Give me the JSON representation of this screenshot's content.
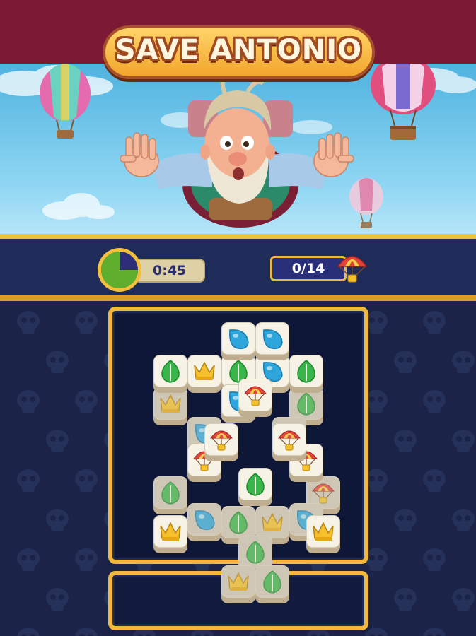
{
  "header": {
    "title": "SAVE ANTONIO"
  },
  "status": {
    "timer_text": "0:45",
    "timer_fraction_remaining": 0.75,
    "goal_text": "0/14"
  },
  "colors": {
    "banner": "#7c1a35",
    "title_fill": "#f2a52c",
    "board_border": "#f1b83a",
    "board_bg": "#0f1738",
    "timer_green": "#5fae2e",
    "timer_purple": "#2e2d7a",
    "leaf": "#39b54a",
    "drop": "#2ea6dc",
    "crown": "#f5c02b",
    "parachute": "#e0433b"
  },
  "board": {
    "tiles": [
      {
        "glyph": "drop-icon",
        "row": 0,
        "col": 2,
        "layer": 2
      },
      {
        "glyph": "drop-icon",
        "row": 0,
        "col": 3,
        "layer": 2
      },
      {
        "glyph": "leaf-icon",
        "row": 1,
        "col": 0,
        "layer": 1
      },
      {
        "glyph": "crown-icon",
        "row": 1,
        "col": 1,
        "layer": 1
      },
      {
        "glyph": "leaf-icon",
        "row": 1,
        "col": 2,
        "layer": 1
      },
      {
        "glyph": "drop-icon",
        "row": 1,
        "col": 3,
        "layer": 1
      },
      {
        "glyph": "leaf-icon",
        "row": 1,
        "col": 4,
        "layer": 1
      },
      {
        "glyph": "crown-icon",
        "row": 2,
        "col": 0,
        "layer": 0
      },
      {
        "glyph": "drop-icon",
        "row": 2,
        "col": 2,
        "layer": 1
      },
      {
        "glyph": "leaf-icon",
        "row": 2,
        "col": 4,
        "layer": 0
      },
      {
        "glyph": "parachute-icon",
        "row": 2,
        "col": 2.5,
        "layer": 3
      },
      {
        "glyph": "drop-icon",
        "row": 3,
        "col": 1,
        "layer": 0
      },
      {
        "glyph": "drop-icon",
        "row": 3,
        "col": 3.5,
        "layer": 0
      },
      {
        "glyph": "parachute-icon",
        "row": 3.5,
        "col": 1.5,
        "layer": 3
      },
      {
        "glyph": "parachute-icon",
        "row": 3.5,
        "col": 3.5,
        "layer": 3
      },
      {
        "glyph": "parachute-icon",
        "row": 4,
        "col": 1,
        "layer": 1
      },
      {
        "glyph": "parachute-icon",
        "row": 4,
        "col": 4,
        "layer": 1
      },
      {
        "glyph": "leaf-icon",
        "row": 5,
        "col": 0,
        "layer": 0
      },
      {
        "glyph": "parachute-icon",
        "row": 5,
        "col": 4.5,
        "layer": 0
      },
      {
        "glyph": "leaf-icon",
        "row": 5,
        "col": 2.5,
        "layer": 3
      },
      {
        "glyph": "drop-icon",
        "row": 6,
        "col": 1,
        "layer": 1
      },
      {
        "glyph": "drop-icon",
        "row": 6,
        "col": 4,
        "layer": 1
      },
      {
        "glyph": "crown-icon",
        "row": 6.5,
        "col": 0,
        "layer": 2
      },
      {
        "glyph": "crown-icon",
        "row": 6.5,
        "col": 4.5,
        "layer": 2
      },
      {
        "glyph": "leaf-icon",
        "row": 6,
        "col": 2,
        "layer": 0
      },
      {
        "glyph": "crown-icon",
        "row": 6,
        "col": 3,
        "layer": 0
      },
      {
        "glyph": "leaf-icon",
        "row": 7,
        "col": 2.5,
        "layer": 0
      },
      {
        "glyph": "crown-icon",
        "row": 8,
        "col": 2,
        "layer": 0
      },
      {
        "glyph": "leaf-icon",
        "row": 8,
        "col": 3,
        "layer": 0
      }
    ],
    "shaded": [
      7,
      9,
      11,
      12,
      17,
      18,
      20,
      21,
      24,
      25,
      26,
      27,
      28
    ]
  },
  "tray": {
    "slots": []
  }
}
